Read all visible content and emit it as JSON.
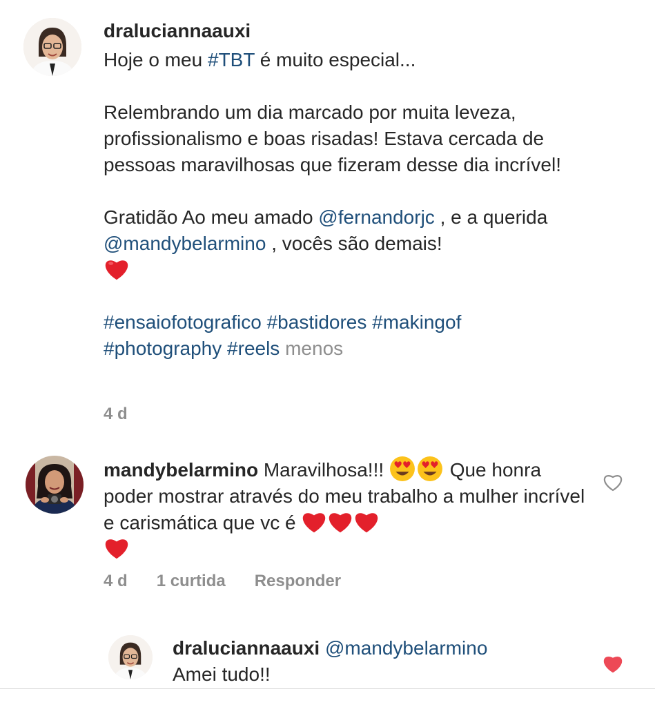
{
  "caption": {
    "username": "draluciannaauxi",
    "line1_prefix": "Hoje o meu ",
    "line1_hashtag": "#TBT",
    "line1_suffix": " é muito especial...",
    "para2": "Relembrando um dia marcado por muita leveza, profissionalismo e boas risadas! Estava cercada de pessoas maravilhosas que fizeram desse dia incrível!",
    "para3_prefix": "Gratidão Ao meu amado ",
    "mention1": "@fernandorjc",
    "para3_mid": " , e a querida ",
    "mention2": "@mandybelarmino",
    "para3_suffix": " , vocês são demais!",
    "hashtag1": "#ensaiofotografico",
    "hashtag2": "#bastidores",
    "hashtag3": "#makingof",
    "hashtag4": "#photography",
    "hashtag5": "#reels",
    "less": "menos",
    "time": "4 d"
  },
  "comment1": {
    "username": "mandybelarmino",
    "text_a": " Maravilhosa!!! ",
    "text_b": " Que honra poder mostrar através do meu trabalho a mulher incrível e carismática que vc é ",
    "time": "4 d",
    "likes": "1 curtida",
    "reply": "Responder",
    "liked": false
  },
  "reply1": {
    "username": "draluciannaauxi",
    "mention": "@mandybelarmino",
    "text": "Amei tudo!!",
    "liked": true
  },
  "colors": {
    "link": "#1f4f7a",
    "muted": "#8e8e8e",
    "like_active": "#ed4956",
    "heart_emoji": "#e3202b"
  },
  "icons": {
    "like_outline": "heart-outline-icon",
    "like_filled": "heart-filled-icon",
    "heart_emoji": "red-heart-emoji",
    "heart_eyes_emoji": "heart-eyes-emoji"
  }
}
